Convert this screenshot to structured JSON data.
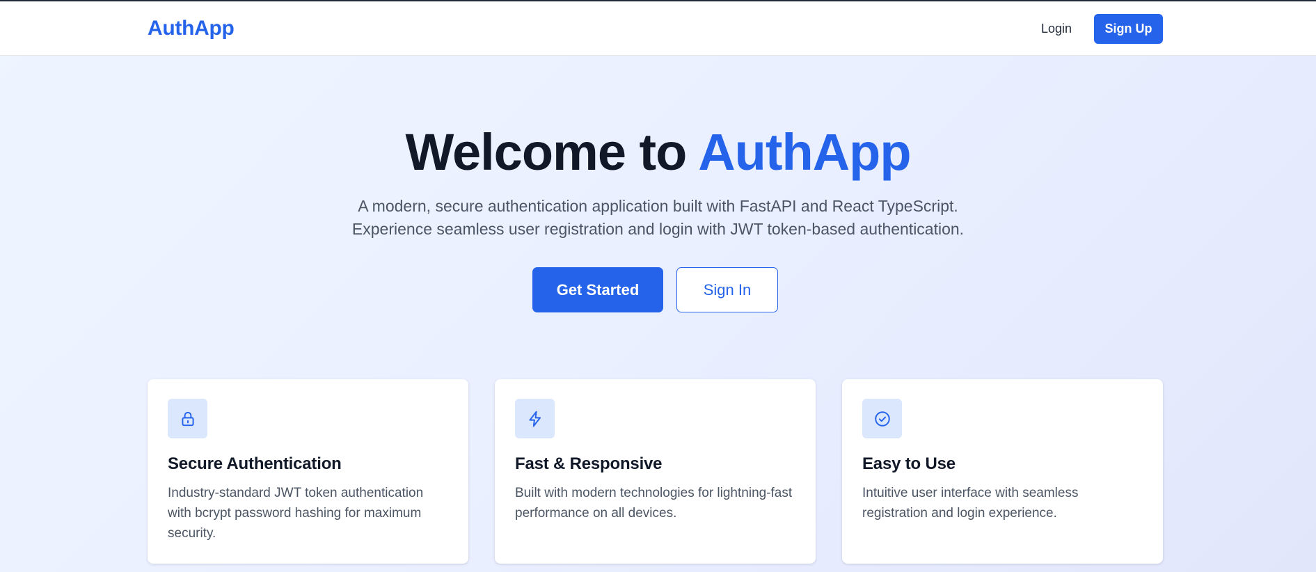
{
  "navbar": {
    "brand": "AuthApp",
    "login_label": "Login",
    "signup_label": "Sign Up"
  },
  "hero": {
    "title_prefix": "Welcome to ",
    "title_accent": "AuthApp",
    "subtitle_line1": "A modern, secure authentication application built with FastAPI and React TypeScript.",
    "subtitle_line2": "Experience seamless user registration and login with JWT token-based authentication.",
    "primary_button": "Get Started",
    "secondary_button": "Sign In"
  },
  "features": [
    {
      "icon": "lock-icon",
      "title": "Secure Authentication",
      "description": "Industry-standard JWT token authentication with bcrypt password hashing for maximum security."
    },
    {
      "icon": "lightning-icon",
      "title": "Fast & Responsive",
      "description": "Built with modern technologies for lightning-fast performance on all devices."
    },
    {
      "icon": "check-circle-icon",
      "title": "Easy to Use",
      "description": "Intuitive user interface with seamless registration and login experience."
    }
  ],
  "colors": {
    "accent": "#2563eb",
    "heading": "#111827",
    "body_text": "#4b5563",
    "icon_bg": "#dbe7fd"
  }
}
